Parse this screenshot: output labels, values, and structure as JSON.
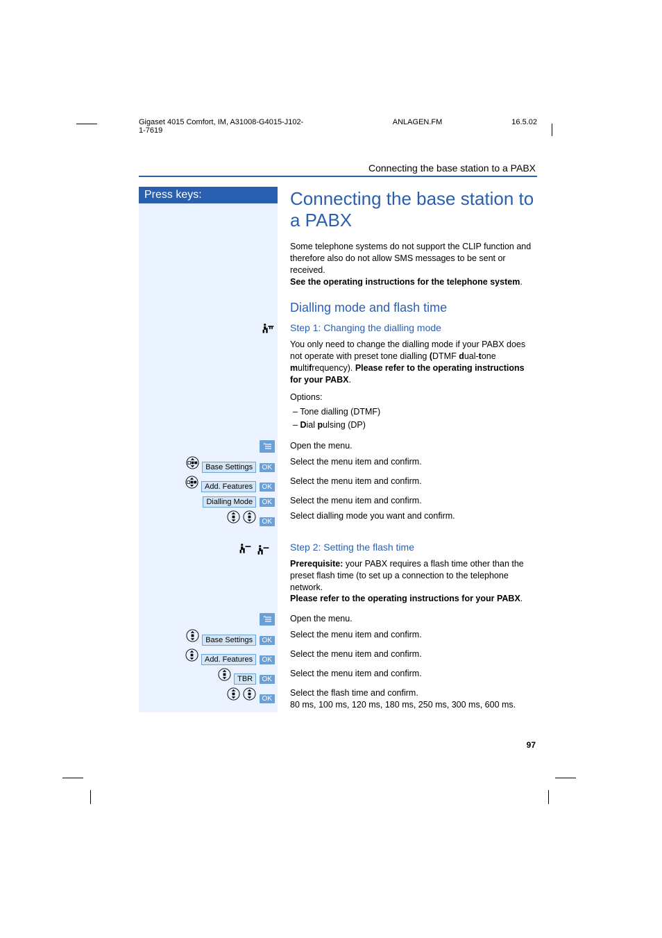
{
  "header": {
    "doc": "Gigaset 4015 Comfort, IM, A31008-G4015-J102-1-7619",
    "file": "ANLAGEN.FM",
    "date": "16.5.02"
  },
  "running_title": "Connecting the base station to a PABX",
  "press_keys": "Press keys:",
  "h1": "Connecting the base station to a PABX",
  "intro1": "Some telephone systems do not support the CLIP function and therefore also do not allow SMS messages to be sent or received.",
  "intro2_bold": "See the operating instructions for the telephone system",
  "h2": "Dialling mode and flash time",
  "step1_h3": "Step 1: Changing the dialling mode",
  "step1_para_pre": "You only need to change the dialling mode if your PABX does not operate with preset tone dialling ",
  "step1_para_bold": "(",
  "step1_dtmf": "DTMF ",
  "step1_para_post": "d",
  "step1_expand": "ual-tone multifrequency). ",
  "step1_refer": "Please refer to the operating instructions for your PABX",
  "options_label": "Options:",
  "options": [
    "Tone dialling (DTMF)",
    "Dial pulsing (DP)"
  ],
  "open_menu": "Open the menu.",
  "select_confirm": "Select the menu item and confirm.",
  "select_dialling": "Select dialling mode you want and confirm.",
  "labels": {
    "base": "Base Settings",
    "add": "Add. Features",
    "dial": "Dialling Mode",
    "tbr": "TBR"
  },
  "ok": "OK",
  "step2_h3": "Step 2: Setting the flash time",
  "prereq_label": "Prerequisite:",
  "prereq_text": " your PABX requires a flash time other than the preset flash time (to set up a connection to the telephone network.",
  "step2_refer": "Please refer to the operating instructions for your PABX",
  "select_flash": "Select the flash time and confirm.",
  "flash_values": "80 ms, 100 ms, 120 ms, 180 ms, 250 ms, 300 ms, 600 ms.",
  "page_number": "97",
  "icons": {
    "menu": "menu-icon",
    "nav": "nav-icon",
    "ok": "ok-icon",
    "construction": "construction-icon"
  }
}
